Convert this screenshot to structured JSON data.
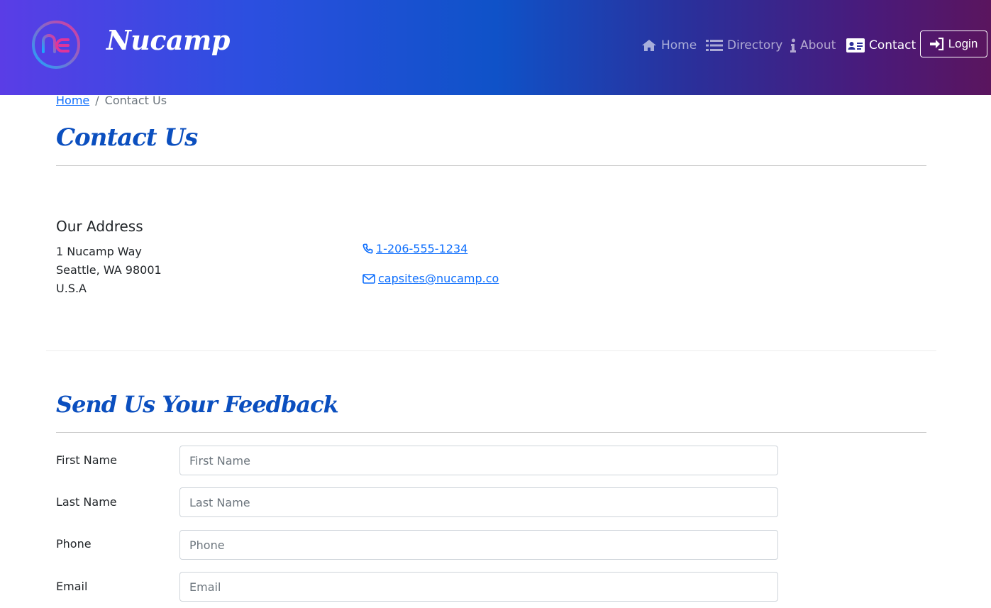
{
  "navbar": {
    "brand": "Nucamp",
    "items": [
      {
        "label": "Home",
        "icon": "home-icon"
      },
      {
        "label": "Directory",
        "icon": "list-icon"
      },
      {
        "label": "About",
        "icon": "info-icon"
      },
      {
        "label": "Contact",
        "icon": "address-card-icon"
      }
    ],
    "login_label": "Login"
  },
  "breadcrumb": {
    "home": "Home",
    "separator": "/",
    "current": "Contact Us"
  },
  "page_title": "Contact Us",
  "address": {
    "title": "Our Address",
    "lines": [
      "1 Nucamp Way",
      "Seattle, WA 98001",
      "U.S.A"
    ]
  },
  "contact": {
    "phone": "1-206-555-1234",
    "email": "capsites@nucamp.co"
  },
  "feedback": {
    "title": "Send Us Your Feedback",
    "fields": [
      {
        "label": "First Name",
        "placeholder": "First Name"
      },
      {
        "label": "Last Name",
        "placeholder": "Last Name"
      },
      {
        "label": "Phone",
        "placeholder": "Phone"
      },
      {
        "label": "Email",
        "placeholder": "Email"
      }
    ]
  },
  "colors": {
    "heading": "#0b4fbf",
    "link": "#0d6efd",
    "gradient_start": "#5a3de6",
    "gradient_end": "#5a155e"
  }
}
